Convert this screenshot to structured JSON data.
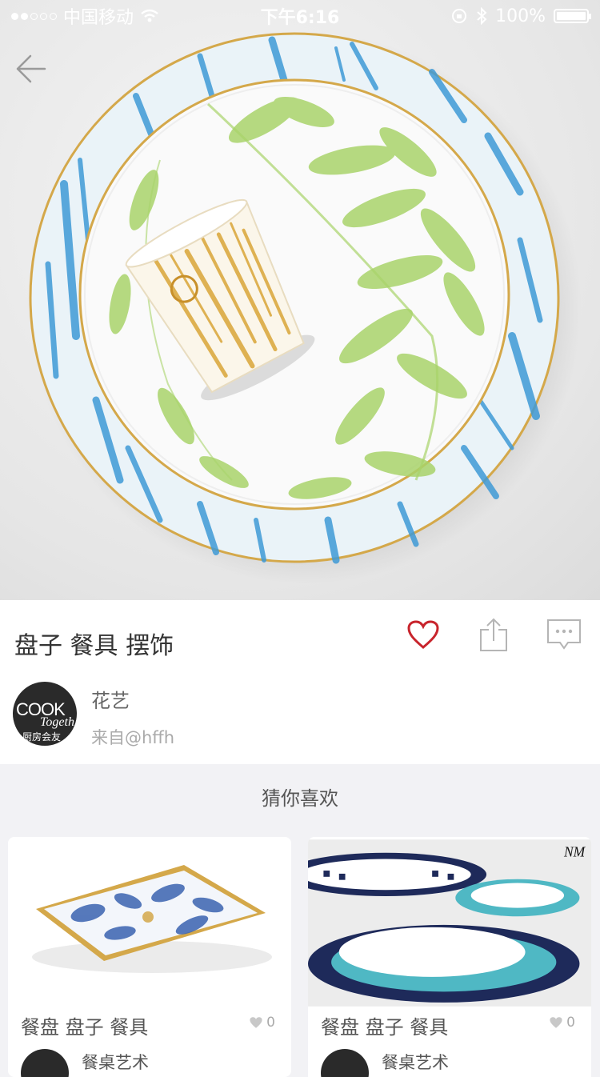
{
  "status_bar": {
    "carrier": "中国移动",
    "time": "下午6:16",
    "battery": "100%"
  },
  "post": {
    "title": "盘子 餐具 摆饰",
    "author_name": "花艺",
    "source": "来自@hffh",
    "avatar_text": {
      "line1": "COOK",
      "line2": "Togeth",
      "line3": "厨房会友"
    }
  },
  "icons": {
    "back": "back-arrow-icon",
    "like": "heart-icon",
    "share": "share-icon",
    "comment": "comment-icon"
  },
  "colors": {
    "heart": "#c8242c",
    "plate_blue": "#3f9ad6",
    "leaf_green": "#a8d36a",
    "gold": "#d4a84a"
  },
  "recommend": {
    "title": "猜你喜欢",
    "cards": [
      {
        "title": "餐盘 盘子 餐具",
        "likes": "0",
        "author": "餐桌艺术"
      },
      {
        "title": "餐盘 盘子 餐具",
        "likes": "0",
        "author": "餐桌艺术",
        "brand_mark": "NM"
      }
    ]
  }
}
